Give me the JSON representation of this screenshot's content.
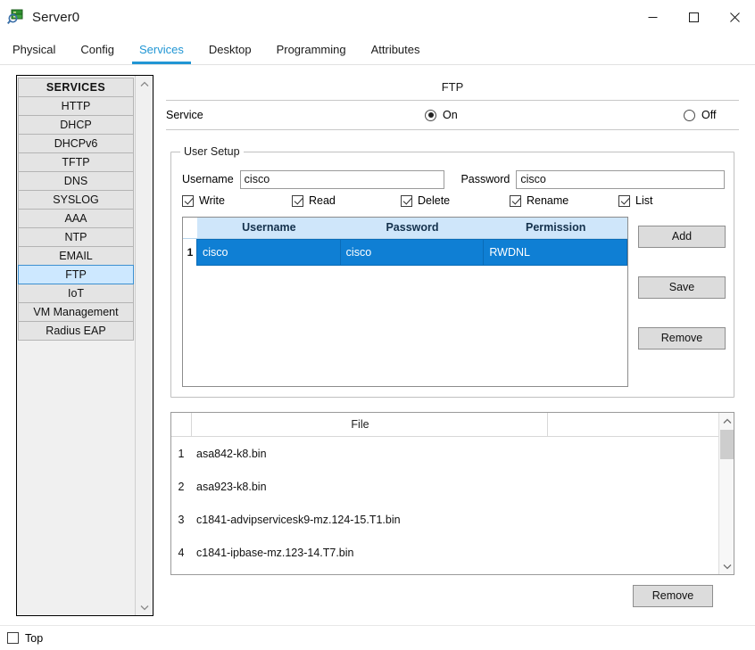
{
  "window": {
    "title": "Server0",
    "icon": "server-magnifier-icon",
    "controls": {
      "minimize": "minimize-icon",
      "maximize": "maximize-icon",
      "close": "close-icon"
    }
  },
  "tabs": [
    {
      "label": "Physical",
      "active": false
    },
    {
      "label": "Config",
      "active": false
    },
    {
      "label": "Services",
      "active": true
    },
    {
      "label": "Desktop",
      "active": false
    },
    {
      "label": "Programming",
      "active": false
    },
    {
      "label": "Attributes",
      "active": false
    }
  ],
  "sidebar": {
    "header": "SERVICES",
    "items": [
      {
        "label": "HTTP",
        "selected": false
      },
      {
        "label": "DHCP",
        "selected": false
      },
      {
        "label": "DHCPv6",
        "selected": false
      },
      {
        "label": "TFTP",
        "selected": false
      },
      {
        "label": "DNS",
        "selected": false
      },
      {
        "label": "SYSLOG",
        "selected": false
      },
      {
        "label": "AAA",
        "selected": false
      },
      {
        "label": "NTP",
        "selected": false
      },
      {
        "label": "EMAIL",
        "selected": false
      },
      {
        "label": "FTP",
        "selected": true
      },
      {
        "label": "IoT",
        "selected": false
      },
      {
        "label": "VM Management",
        "selected": false
      },
      {
        "label": "Radius EAP",
        "selected": false
      }
    ],
    "scroll_up": "chevron-up-icon",
    "scroll_down": "chevron-down-icon"
  },
  "main": {
    "panel_title": "FTP",
    "service": {
      "label": "Service",
      "on_label": "On",
      "off_label": "Off",
      "selected": "On"
    },
    "user_setup": {
      "legend": "User Setup",
      "username_label": "Username",
      "username_value": "cisco",
      "password_label": "Password",
      "password_value": "cisco",
      "permissions": [
        {
          "label": "Write",
          "checked": true
        },
        {
          "label": "Read",
          "checked": true
        },
        {
          "label": "Delete",
          "checked": true
        },
        {
          "label": "Rename",
          "checked": true
        },
        {
          "label": "List",
          "checked": true
        }
      ],
      "table": {
        "columns": [
          "Username",
          "Password",
          "Permission"
        ],
        "rows": [
          {
            "index": "1",
            "username": "cisco",
            "password": "cisco",
            "permission": "RWDNL",
            "selected": true
          }
        ]
      },
      "buttons": {
        "add": "Add",
        "save": "Save",
        "remove": "Remove"
      }
    },
    "file_list": {
      "column_header": "File",
      "files": [
        {
          "index": "1",
          "name": "asa842-k8.bin"
        },
        {
          "index": "2",
          "name": "asa923-k8.bin"
        },
        {
          "index": "3",
          "name": "c1841-advipservicesk9-mz.124-15.T1.bin"
        },
        {
          "index": "4",
          "name": "c1841-ipbase-mz.123-14.T7.bin"
        }
      ],
      "scroll_up": "chevron-up-icon",
      "scroll_down": "chevron-down-icon"
    },
    "remove_file_button": "Remove"
  },
  "statusbar": {
    "top_checkbox_label": "Top",
    "top_checked": false
  },
  "colors": {
    "accent": "#2196d4",
    "selected_row": "#0f7fd4",
    "table_header": "#cfe6fa",
    "sidebar_selected": "#cde8ff"
  }
}
